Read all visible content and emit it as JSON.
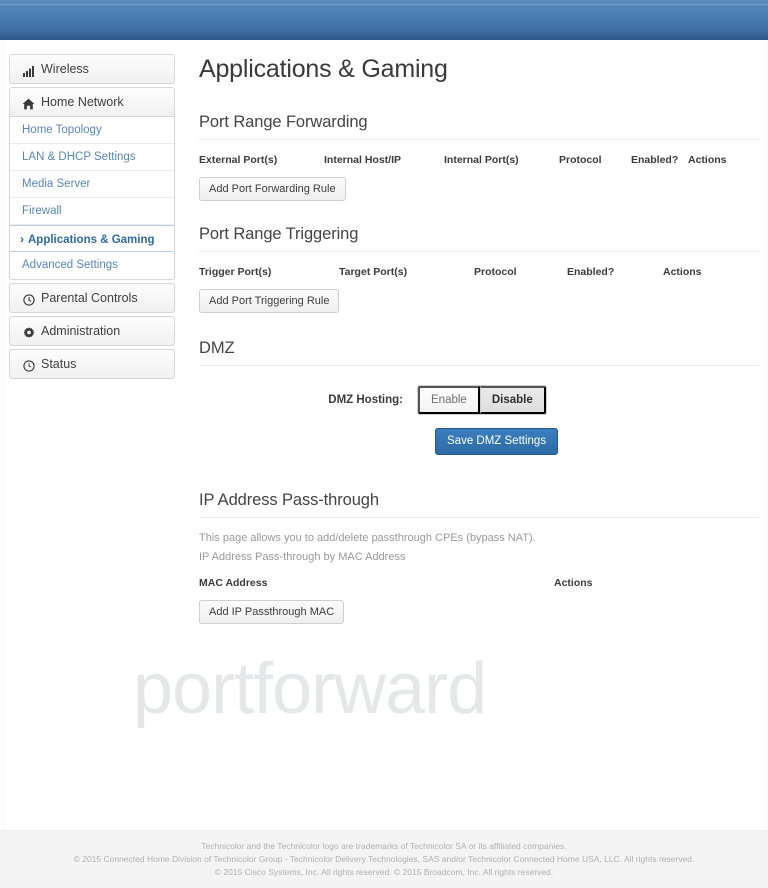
{
  "header": {
    "bar_color": "#3f6fa4"
  },
  "sidebar": {
    "groups": [
      {
        "label": "Wireless",
        "icon": "signal-bars-icon"
      },
      {
        "label": "Home Network",
        "icon": "home-icon"
      },
      {
        "label": "Parental Controls",
        "icon": "clock-icon"
      },
      {
        "label": "Administration",
        "icon": "gear-icon"
      },
      {
        "label": "Status",
        "icon": "clock-outline-icon"
      }
    ],
    "home_network_items": [
      {
        "label": "Home Topology",
        "active": false
      },
      {
        "label": "LAN & DHCP Settings",
        "active": false
      },
      {
        "label": "Media Server",
        "active": false
      },
      {
        "label": "Firewall",
        "active": false
      },
      {
        "label": "Applications & Gaming",
        "active": true
      },
      {
        "label": "Advanced Settings",
        "active": false
      }
    ],
    "active_chevron": "›",
    "link_color": "#5a86b8",
    "active_color": "#2f6aa8"
  },
  "main": {
    "page_title": "Applications & Gaming",
    "port_forwarding": {
      "title": "Port Range Forwarding",
      "columns": [
        "External Port(s)",
        "Internal Host/IP",
        "Internal Port(s)",
        "Protocol",
        "Enabled?",
        "Actions"
      ],
      "rows": [],
      "add_button": "Add Port Forwarding Rule"
    },
    "port_triggering": {
      "title": "Port Range Triggering",
      "columns": [
        "Trigger Port(s)",
        "Target Port(s)",
        "Protocol",
        "Enabled?",
        "Actions"
      ],
      "rows": [],
      "add_button": "Add Port Triggering Rule"
    },
    "dmz": {
      "title": "DMZ",
      "field_label": "DMZ Hosting:",
      "enable_label": "Enable",
      "disable_label": "Disable",
      "selected": "Disable",
      "save_button": "Save DMZ Settings",
      "save_button_color": "#2d6ba6"
    },
    "passthrough": {
      "title": "IP Address Pass-through",
      "description": "This page allows you to add/delete passthrough CPEs (bypass NAT).",
      "subtitle": "IP Address Pass-through by MAC Address",
      "columns": [
        "MAC Address",
        "Actions"
      ],
      "rows": [],
      "add_button": "Add IP Passthrough MAC"
    }
  },
  "watermark": {
    "text": "portforward"
  },
  "footer": {
    "line1": "Technicolor and the Technicolor logo are trademarks of Technicolor SA or its affiliated companies.",
    "line2": "© 2015 Connected Home Division of Technicolor Group - Technicolor Delivery Technologies, SAS and/or Technicolor Connected Home USA, LLC. All rights reserved.",
    "line3": "© 2015 Cisco Systems, Inc. All rights reserved. © 2015 Broadcom, Inc. All rights reserved."
  }
}
